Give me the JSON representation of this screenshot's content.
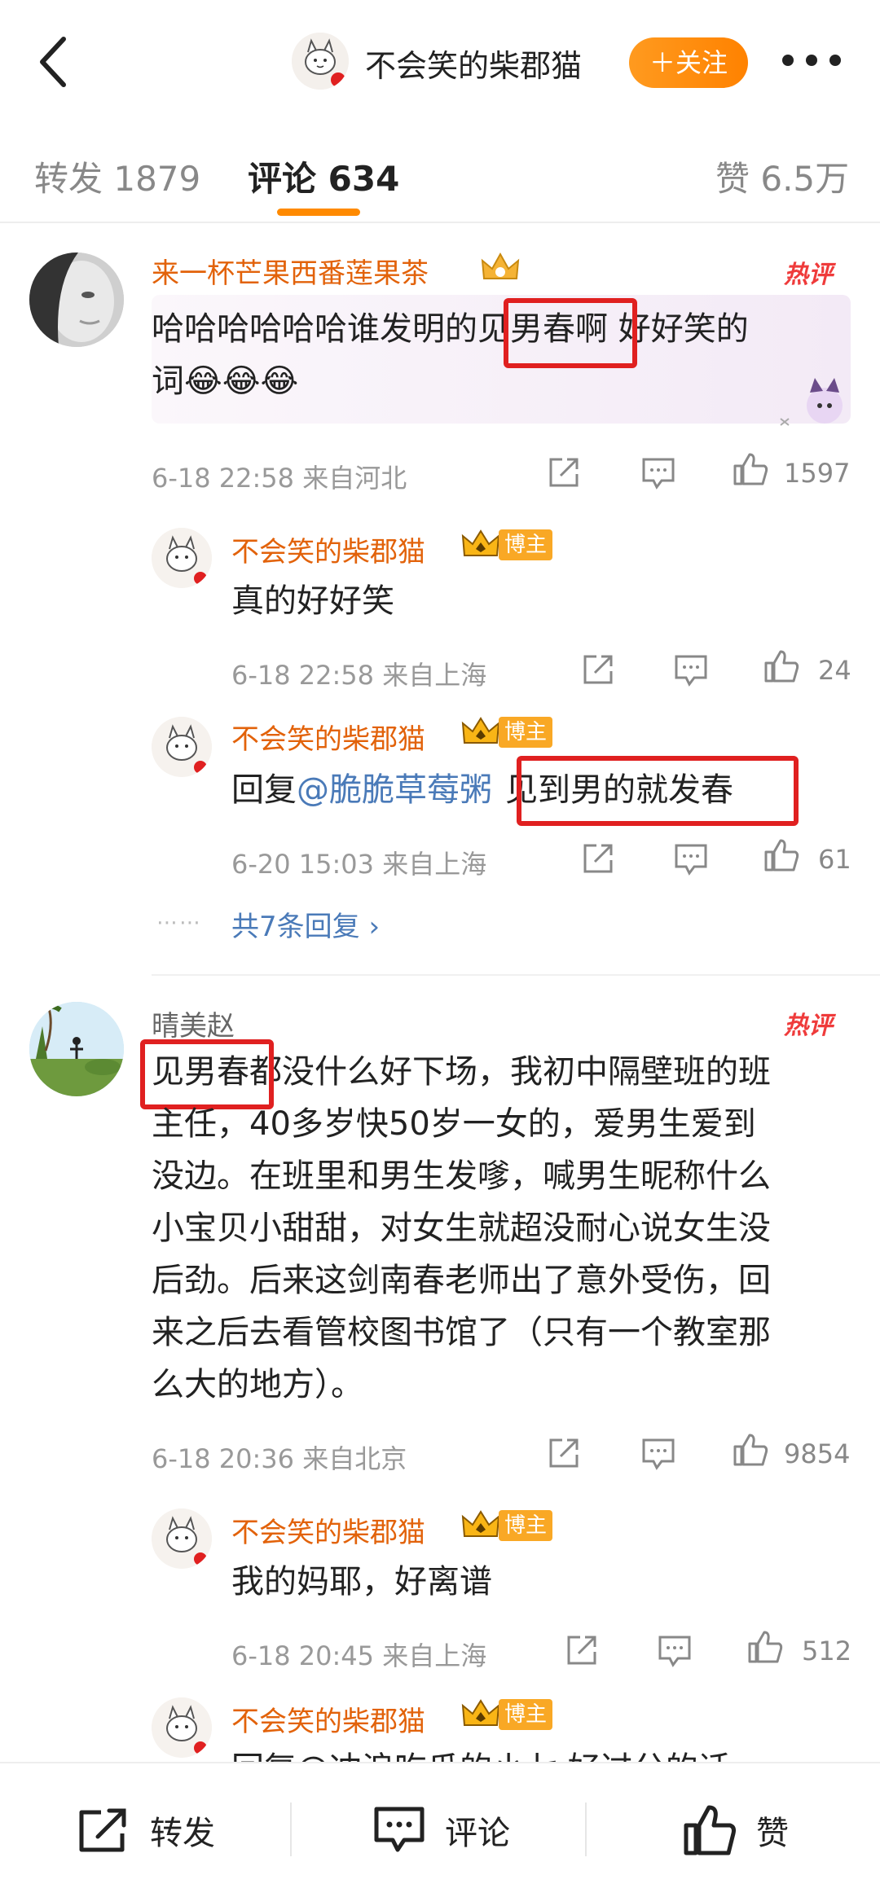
{
  "header": {
    "title": "不会笑的柴郡猫",
    "follow_label": "＋关注"
  },
  "tabs": [
    {
      "label": "转发 1879"
    },
    {
      "label": "评论 634"
    },
    {
      "label": "赞 6.5万"
    }
  ],
  "comments": [
    {
      "user": "来一杯芒果西番莲果茶",
      "hot_label": "热评",
      "text_line1_a": "哈哈哈哈哈哈谁发明的",
      "text_line1_hl": "见男春",
      "text_line1_b": "啊 好好笑的",
      "text_line2": "词😂😂😂",
      "meta": "6-18 22:58  来自河北",
      "likes": "1597",
      "replies": [
        {
          "user": "不会笑的柴郡猫",
          "badge": "博主",
          "text": "真的好好笑",
          "meta": "6-18 22:58  来自上海",
          "likes": "24"
        },
        {
          "user": "不会笑的柴郡猫",
          "badge": "博主",
          "prefix": "回复",
          "mention": "@脆脆草莓粥",
          "highlight": "见到男的就发春",
          "meta": "6-20 15:03  来自上海",
          "likes": "61"
        }
      ],
      "more_replies": "共7条回复 ›"
    },
    {
      "user": "晴美赵",
      "hot_label": "热评",
      "text_hl": "见男春",
      "text_line1_rest": "都没什么好下场，我初中隔壁班的班",
      "text_rest_lines": [
        "主任，40多岁快50岁一女的，爱男生爱到",
        "没边。在班里和男生发嗲，喊男生昵称什么",
        "小宝贝小甜甜，对女生就超没耐心说女生没",
        "后劲。后来这剑南春老师出了意外受伤，回",
        "来之后去看管校图书馆了（只有一个教室那",
        "么大的地方）。"
      ],
      "meta": "6-18 20:36  来自北京",
      "likes": "9854",
      "replies": [
        {
          "user": "不会笑的柴郡猫",
          "badge": "博主",
          "text": "我的妈耶，好离谱",
          "meta": "6-18 20:45  来自上海",
          "likes": "512"
        },
        {
          "user": "不会笑的柴郡猫",
          "badge": "博主",
          "partial": "回复@冲浪吃瓜的小七 好过分的话"
        }
      ]
    }
  ],
  "bottom": {
    "repost": "转发",
    "comment": "评论",
    "like": "赞"
  },
  "colors": {
    "accent": "#ff8a00",
    "username": "#e2620a",
    "link": "#4a7ab8",
    "highlight_box": "#e02020"
  }
}
